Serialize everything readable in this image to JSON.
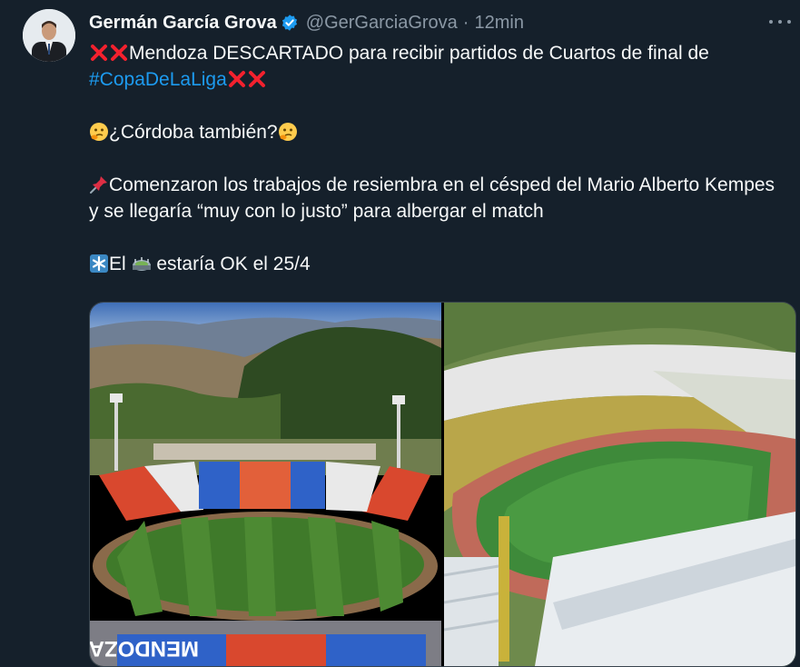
{
  "tweet": {
    "author_name": "Germán García Grova",
    "handle": "@GerGarciaGrova",
    "separator": "·",
    "time": "12min",
    "line1": "Mendoza DESCARTADO para recibir partidos de Cuartos de final de",
    "hashtag": "#CopaDeLaLiga",
    "line2": "¿Córdoba también?",
    "line3": "Comenzaron los trabajos de resiembra en el césped del Mario Alberto Kempes y se llegaría “muy con lo justo” para albergar el match",
    "line4_before": "El",
    "line4_after": "estaría OK el 25/4",
    "stadium_sign": "MENDOZA"
  },
  "colors": {
    "background": "#15202b",
    "hashtag": "#1d9bf0",
    "cross": "#f4212e",
    "verified": "#1d9bf0",
    "muted": "#8b98a5"
  },
  "icons": [
    "verified-badge-icon",
    "more-options-icon",
    "cross-emoji-icon",
    "thinking-emoji-icon",
    "pushpin-emoji-icon",
    "asterisk-emoji-icon",
    "stadium-emoji-icon"
  ]
}
